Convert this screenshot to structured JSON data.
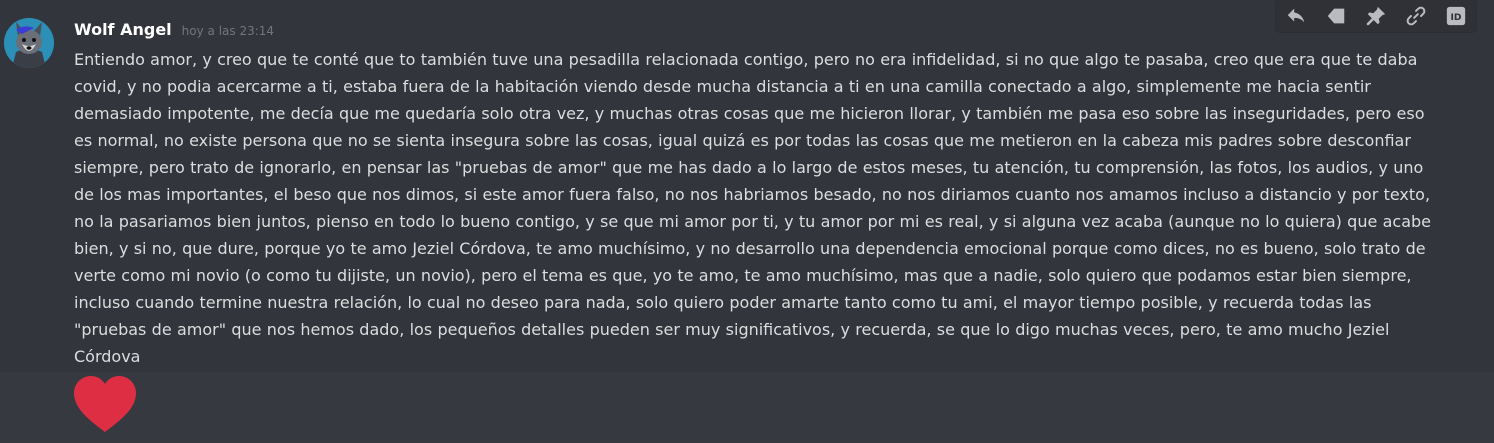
{
  "message": {
    "author": "Wolf Angel",
    "timestamp": "hoy a las 23:14",
    "text": "Entiendo amor, y creo que te conté que to también tuve una pesadilla relacionada contigo, pero no era infidelidad, si no que algo te pasaba, creo que era que te daba covid, y no podia acercarme a ti, estaba fuera de la habitación viendo desde mucha distancia a ti en una camilla conectado a algo, simplemente me hacia sentir demasiado impotente, me decía que me quedaría solo otra vez, y muchas otras cosas que me hicieron llorar, y también me pasa eso sobre las inseguridades, pero eso es normal, no existe persona que no se sienta insegura sobre las cosas, igual quizá es por todas las cosas que me metieron en la cabeza mis padres sobre desconfiar siempre, pero trato de ignorarlo, en pensar las \"pruebas de amor\" que me has dado a lo largo de estos meses, tu atención, tu comprensión, las fotos, los audios, y uno de los mas importantes, el beso que nos dimos, si este amor fuera falso, no nos habriamos besado, no nos diriamos cuanto nos amamos incluso a distancio y por texto, no la pasariamos bien juntos, pienso en todo lo bueno contigo, y se que mi amor por ti, y tu amor por mi es real, y si alguna vez acaba (aunque no lo quiera) que acabe bien, y si no, que dure, porque yo te amo Jeziel Córdova, te amo muchísimo, y no desarrollo una dependencia emocional porque como dices, no es bueno, solo trato de verte como mi novio (o como tu dijiste, un novio), pero el tema es que, yo te amo, te amo muchísimo, mas que a nadie, solo quiero que podamos estar bien siempre, incluso cuando termine nuestra relación, lo cual no deseo para nada, solo quiero poder amarte tanto como tu ami, el mayor tiempo posible, y recuerda todas las \"pruebas de amor\" que nos hemos dado, los pequeños detalles pueden ser muy significativos, y recuerda, se que lo digo muchas veces, pero, te amo mucho Jeziel Córdova"
  },
  "toolbar": {
    "icons": [
      "reply-icon",
      "tag-icon",
      "pin-icon",
      "link-icon",
      "id-icon"
    ],
    "id_label": "ID"
  },
  "reaction": {
    "icon": "heart-icon",
    "color": "#dd2e44"
  },
  "colors": {
    "background": "#36393f",
    "message_hover": "#32353b",
    "username": "#ffffff",
    "timestamp": "#72767d",
    "text": "#dcddde",
    "toolbar_bg": "#2f3136",
    "icon": "#b9bbbe"
  }
}
